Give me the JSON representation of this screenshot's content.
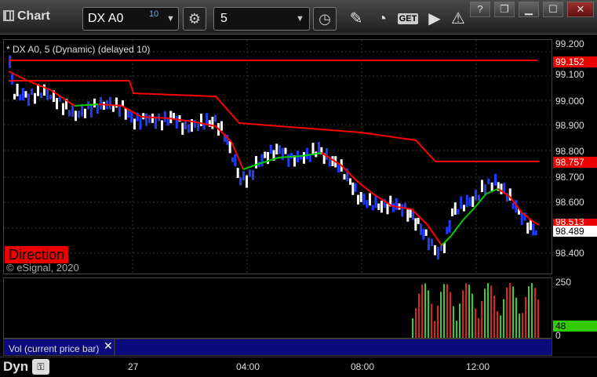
{
  "app_title": "Chart",
  "symbol": {
    "value": "DX A0",
    "superscript": "10"
  },
  "interval": {
    "value": "5"
  },
  "toolbar": {
    "get_label": "GET"
  },
  "window_buttons": {
    "help": "?",
    "restore": "❐",
    "minimize": "▁",
    "maximize": "☐",
    "close": "✕"
  },
  "chart": {
    "legend": "* DX A0, 5 (Dynamic) (delayed 10)",
    "direction_label": "Direction",
    "copyright": "© eSignal, 2020",
    "price_labels": [
      "99.200",
      "99.100",
      "99.000",
      "98.900",
      "98.800",
      "98.700",
      "98.600",
      "98.400"
    ],
    "tags": {
      "stop_high": "99.152",
      "stop_mid": "98.757",
      "ma_value": "98.513",
      "last_price": "98.489"
    },
    "colors": {
      "stop_line": "#ff0000",
      "ma_down": "#ff0000",
      "ma_up": "#00cc00",
      "bar_up": "#ffffff",
      "bar_down": "#1e3cff",
      "grid": "#333333"
    }
  },
  "volume": {
    "label": "Vol (current price bar)",
    "close": "✕",
    "axis_labels": [
      "250",
      "0"
    ],
    "current_value": "48"
  },
  "bottom": {
    "mode": "Dyn",
    "time_labels": [
      "27",
      "04:00",
      "08:00",
      "12:00"
    ]
  }
}
